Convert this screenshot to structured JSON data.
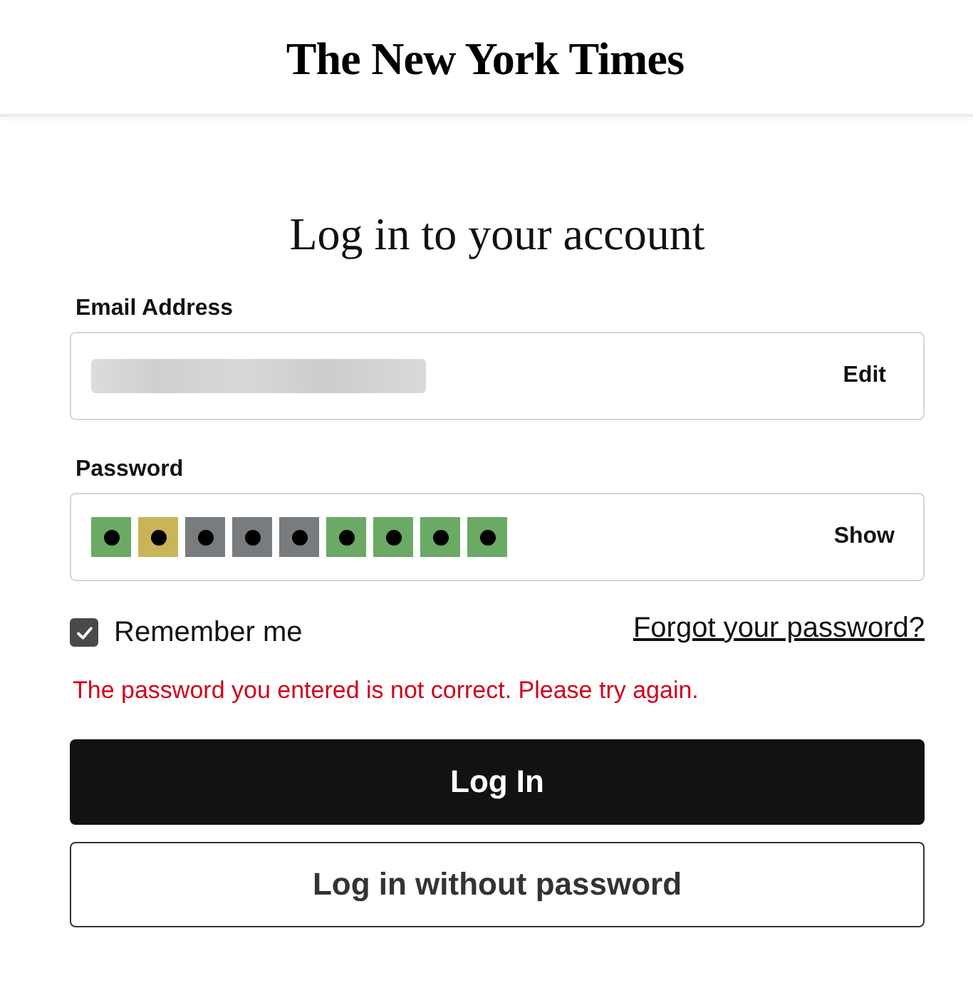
{
  "header": {
    "logo": "The New York Times"
  },
  "title": "Log in to your account",
  "email": {
    "label": "Email Address",
    "redacted": true,
    "action": "Edit"
  },
  "password": {
    "label": "Password",
    "characters": [
      {
        "color": "#6aaa64"
      },
      {
        "color": "#c9b458"
      },
      {
        "color": "#787c7e"
      },
      {
        "color": "#787c7e"
      },
      {
        "color": "#787c7e"
      },
      {
        "color": "#6aaa64"
      },
      {
        "color": "#6aaa64"
      },
      {
        "color": "#6aaa64"
      },
      {
        "color": "#6aaa64"
      }
    ],
    "action": "Show"
  },
  "remember": {
    "label": "Remember me",
    "checked": true
  },
  "forgot_link": "Forgot your password?",
  "error": "The password you entered is not correct. Please try again.",
  "buttons": [
    {
      "label": "Log In",
      "kind": "primary"
    },
    {
      "label": "Log in without password",
      "kind": "secondary"
    }
  ]
}
